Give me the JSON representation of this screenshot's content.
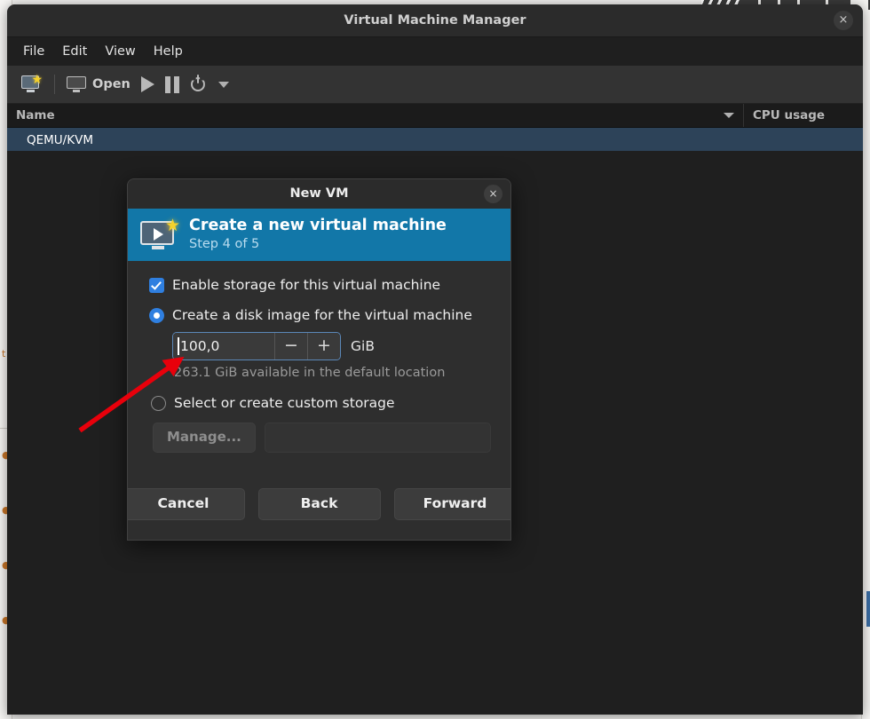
{
  "window": {
    "title": "Virtual Machine Manager",
    "close_label": "×",
    "close_icon": "close-icon"
  },
  "menubar": {
    "items": [
      {
        "label": "File"
      },
      {
        "label": "Edit"
      },
      {
        "label": "View"
      },
      {
        "label": "Help"
      }
    ]
  },
  "toolbar": {
    "new_vm_icon": "new-vm-icon",
    "open_icon": "monitor-icon",
    "open_label": "Open",
    "run_icon": "play-icon",
    "pause_icon": "pause-icon",
    "shutdown_icon": "power-icon",
    "shutdown_menu_icon": "chevron-down-icon"
  },
  "vm_list": {
    "columns": [
      {
        "label": "Name",
        "sort_icon": "sort-descending-icon"
      },
      {
        "label": "CPU usage"
      }
    ],
    "rows": [
      {
        "name": "QEMU/KVM",
        "cpu_usage": ""
      }
    ]
  },
  "dialog": {
    "title": "New VM",
    "close_label": "×",
    "close_icon": "close-icon",
    "banner": {
      "icon": "create-vm-icon",
      "title": "Create a new virtual machine",
      "subtitle": "Step 4 of 5"
    },
    "enable_storage": {
      "label": "Enable storage for this virtual machine",
      "checked": true
    },
    "create_disk": {
      "label": "Create a disk image for the virtual machine",
      "selected": true,
      "size_value": "100,0",
      "size_unit": "GiB",
      "decrement_label": "−",
      "increment_label": "+",
      "available_text": "263.1 GiB available in the default location"
    },
    "custom_storage": {
      "label": "Select or create custom storage",
      "selected": false,
      "manage_label": "Manage...",
      "path_value": "",
      "path_placeholder": ""
    },
    "footer": {
      "cancel_label": "Cancel",
      "back_label": "Back",
      "forward_label": "Forward"
    }
  },
  "annotation": {
    "arrow_color": "#e8000b",
    "arrow_name": "red-pointer-arrow"
  },
  "colors": {
    "accent": "#1277a8",
    "control_accent": "#2f7fe0",
    "selection": "#2d4359",
    "window_bg": "#1e1e1e",
    "dialog_bg": "#2e2e2e"
  }
}
